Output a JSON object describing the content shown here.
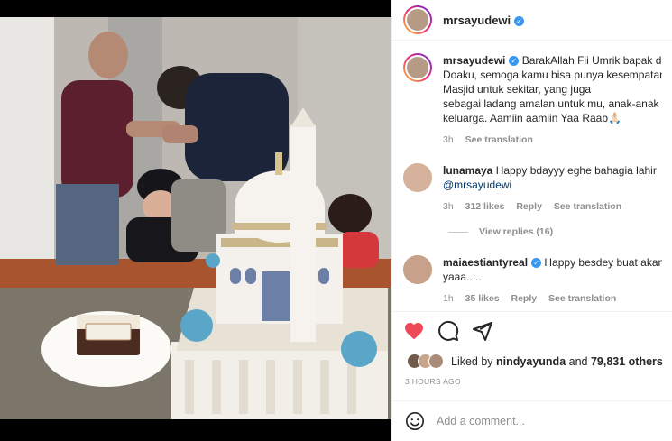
{
  "header": {
    "username": "mrsayudewi"
  },
  "caption": {
    "username": "mrsayudewi",
    "line1": "BarakAllah Fii Umrik bapak dari",
    "line2": "Doaku, semoga kamu bisa punya kesempatan m",
    "line3": "Masjid untuk sekitar, yang juga",
    "line4": "sebagai ladang amalan untuk mu, anak-anak ke",
    "line5": "keluarga. Aamiin aamiin Yaa Raab",
    "emoji": "🙏🏻",
    "time": "3h",
    "see_translation": "See translation"
  },
  "comment1": {
    "username": "lunamaya",
    "line1": "Happy bdayyy eghe bahagia lahir",
    "line2": "@mrsayudewi",
    "time": "3h",
    "likes": "312 likes",
    "reply": "Reply",
    "see_translation": "See translation"
  },
  "view_replies": "View replies (16)",
  "comment2": {
    "username": "maiaestiantyreal",
    "line1": "Happy besdey buat akang t",
    "line2": "yaaa.....",
    "time": "1h",
    "likes": "35 likes",
    "reply": "Reply",
    "see_translation": "See translation"
  },
  "likes": {
    "prefix": "Liked by",
    "user": "nindyayunda",
    "and": "and",
    "others": "79,831 others"
  },
  "timestamp": "3 HOURS AGO",
  "add_comment": {
    "placeholder": "Add a comment..."
  },
  "colors": {
    "like_red": "#ed4956",
    "verified_blue": "#3897f0"
  }
}
